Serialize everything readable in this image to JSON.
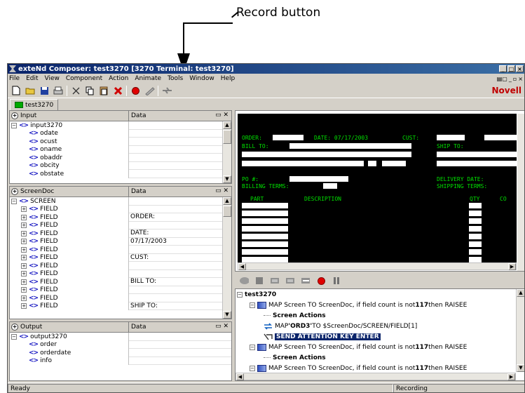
{
  "callout": {
    "label": "Record button"
  },
  "window": {
    "title": "exteNd Composer: test3270 [3270 Terminal: test3270]"
  },
  "menu": [
    "File",
    "Edit",
    "View",
    "Component",
    "Action",
    "Animate",
    "Tools",
    "Window",
    "Help"
  ],
  "brand": "Novell",
  "tab": {
    "label": "test3270"
  },
  "panels": {
    "input": {
      "header": "Input",
      "data_header": "Data",
      "rows": [
        {
          "expand": "−",
          "name": "input3270",
          "value": "",
          "indent": 0
        },
        {
          "expand": "",
          "name": "odate",
          "value": "",
          "indent": 1
        },
        {
          "expand": "",
          "name": "ocust",
          "value": "",
          "indent": 1
        },
        {
          "expand": "",
          "name": "oname",
          "value": "",
          "indent": 1
        },
        {
          "expand": "",
          "name": "obaddr",
          "value": "",
          "indent": 1
        },
        {
          "expand": "",
          "name": "obcity",
          "value": "",
          "indent": 1
        },
        {
          "expand": "",
          "name": "obstate",
          "value": "",
          "indent": 1
        }
      ]
    },
    "screendoc": {
      "header": "ScreenDoc",
      "data_header": "Data",
      "rows": [
        {
          "expand": "−",
          "name": "SCREEN",
          "value": "",
          "indent": 0
        },
        {
          "expand": "+",
          "name": "FIELD",
          "value": "",
          "indent": 1
        },
        {
          "expand": "+",
          "name": "FIELD",
          "value": "ORDER:",
          "indent": 1
        },
        {
          "expand": "+",
          "name": "FIELD",
          "value": "",
          "indent": 1
        },
        {
          "expand": "+",
          "name": "FIELD",
          "value": "DATE:",
          "indent": 1
        },
        {
          "expand": "+",
          "name": "FIELD",
          "value": "07/17/2003",
          "indent": 1
        },
        {
          "expand": "+",
          "name": "FIELD",
          "value": "",
          "indent": 1
        },
        {
          "expand": "+",
          "name": "FIELD",
          "value": "CUST:",
          "indent": 1
        },
        {
          "expand": "+",
          "name": "FIELD",
          "value": "",
          "indent": 1
        },
        {
          "expand": "+",
          "name": "FIELD",
          "value": "",
          "indent": 1
        },
        {
          "expand": "+",
          "name": "FIELD",
          "value": "BILL TO:",
          "indent": 1
        },
        {
          "expand": "+",
          "name": "FIELD",
          "value": "",
          "indent": 1
        },
        {
          "expand": "+",
          "name": "FIELD",
          "value": "",
          "indent": 1
        },
        {
          "expand": "+",
          "name": "FIELD",
          "value": "SHIP TO:",
          "indent": 1
        }
      ]
    },
    "output": {
      "header": "Output",
      "data_header": "Data",
      "rows": [
        {
          "expand": "−",
          "name": "output3270",
          "value": "",
          "indent": 0
        },
        {
          "expand": "",
          "name": "order",
          "value": "",
          "indent": 1
        },
        {
          "expand": "",
          "name": "orderdate",
          "value": "",
          "indent": 1
        },
        {
          "expand": "",
          "name": "info",
          "value": "",
          "indent": 1
        }
      ]
    }
  },
  "terminal": {
    "order_label": "ORDER:",
    "date_label": "DATE: 07/17/2003",
    "cust_label": "CUST:",
    "bill_to": "BILL TO:",
    "ship_to": "SHIP TO:",
    "po": "PO #:",
    "delivery_date": "DELIVERY DATE:",
    "billing_terms": "BILLING TERMS:",
    "shipping_terms": "SHIPPING TERMS:",
    "part": "PART",
    "description": "DESCRIPTION",
    "qty": "QTY",
    "co": "CO"
  },
  "actions": {
    "root": "test3270",
    "items": [
      {
        "type": "map",
        "text_pre": "MAP Screen TO ScreenDoc, if field count is not ",
        "bold": "117",
        "text_post": " then RAISEE",
        "indent": 1
      },
      {
        "type": "sa",
        "text": "Screen Actions",
        "indent": 2
      },
      {
        "type": "mapstr",
        "text_pre": "MAP ",
        "bold": "'ORD3'",
        "text_post": " TO $ScreenDoc/SCREEN/FIELD[1]",
        "indent": 2
      },
      {
        "type": "send",
        "text": "SEND ATTENTION KEY ENTER",
        "indent": 2
      },
      {
        "type": "map",
        "text_pre": "MAP Screen TO ScreenDoc, if field count is not ",
        "bold": "117",
        "text_post": " then RAISEE",
        "indent": 1
      },
      {
        "type": "sa",
        "text": "Screen Actions",
        "indent": 2
      },
      {
        "type": "map",
        "text_pre": "MAP Screen TO ScreenDoc, if field count is not ",
        "bold": "117",
        "text_post": " then RAISEE",
        "indent": 1
      }
    ]
  },
  "status": {
    "left": "Ready",
    "right": "Recording"
  }
}
